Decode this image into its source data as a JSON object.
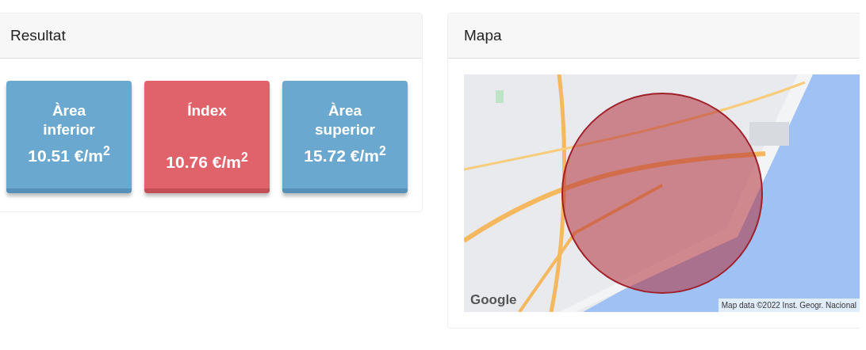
{
  "result_card": {
    "title": "Resultat",
    "tiles": [
      {
        "kind": "range",
        "label": "Àrea inferior",
        "value": "10.51 €/m$^{2}$"
      },
      {
        "kind": "index",
        "label": "Índex",
        "value": "10.76 €/m$^{2}$"
      },
      {
        "kind": "range",
        "label": "Àrea superior",
        "value": "15.72 €/m$^{2}$"
      }
    ]
  },
  "map_card": {
    "title": "Mapa",
    "map": {
      "kind": "picture",
      "logo": "Google",
      "attribution": "Map data ©2022 Inst. Geogr. Nacional"
    }
  }
}
